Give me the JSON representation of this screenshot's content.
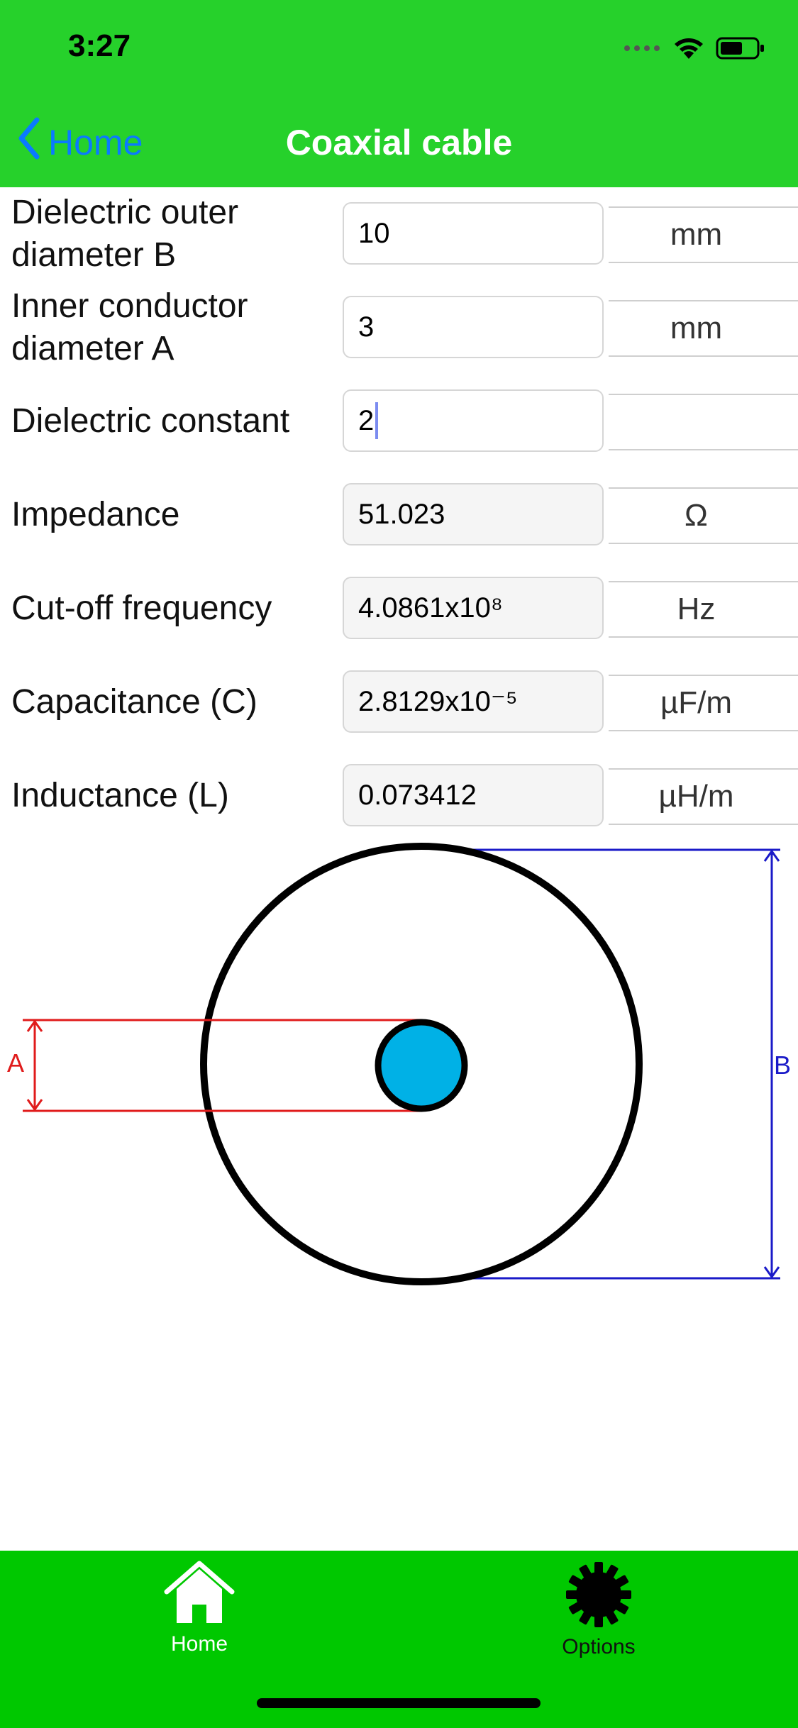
{
  "status_bar": {
    "time": "3:27"
  },
  "nav": {
    "back_label": "Home",
    "title": "Coaxial cable"
  },
  "form": {
    "rows": [
      {
        "label": "Dielectric outer diameter B",
        "value": "10",
        "unit": "mm",
        "editable": true
      },
      {
        "label": "Inner conductor diameter A",
        "value": "3",
        "unit": "mm",
        "editable": true
      },
      {
        "label": "Dielectric constant",
        "value": "2",
        "unit": "",
        "editable": true,
        "focused": true
      },
      {
        "label": "Impedance",
        "value": "51.023",
        "unit": "Ω",
        "editable": false
      },
      {
        "label": "Cut-off frequency",
        "value": "4.0861x10⁸",
        "unit": "Hz",
        "editable": false
      },
      {
        "label": "Capacitance (C)",
        "value": "2.8129x10⁻⁵",
        "unit": "µF/m",
        "editable": false
      },
      {
        "label": "Inductance (L)",
        "value": "0.073412",
        "unit": "µH/m",
        "editable": false
      }
    ]
  },
  "diagram": {
    "label_a": "A",
    "label_b": "B",
    "colors": {
      "outer_ring": "#000000",
      "inner_conductor": "#00b1e6",
      "dimension_a": "#e01b1b",
      "dimension_b": "#1a1ac8"
    }
  },
  "tabbar": {
    "tabs": [
      {
        "label": "Home",
        "icon": "home-icon",
        "active": true
      },
      {
        "label": "Options",
        "icon": "gear-icon",
        "active": false
      }
    ]
  },
  "colors": {
    "header_bg": "#26d12b",
    "tabbar_bg": "#00c800",
    "link_blue": "#0a7aff"
  }
}
